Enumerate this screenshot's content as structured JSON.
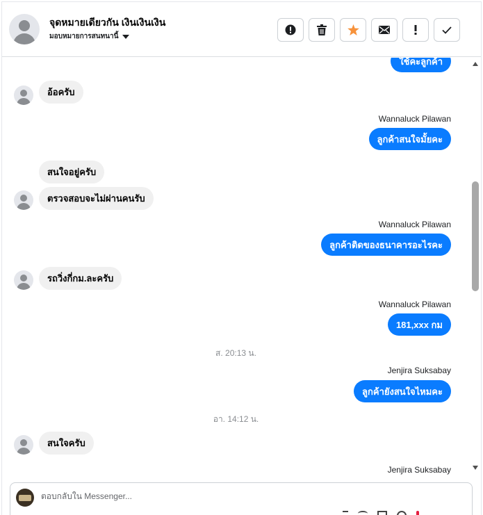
{
  "header": {
    "contact_name": "จุดหมายเดียวกัน เงินเงินเงิน",
    "assign_label": "มอบหมายการสนทนานี้",
    "actions": [
      {
        "name": "spam-button",
        "icon": "alert-circle-icon"
      },
      {
        "name": "delete-button",
        "icon": "trash-icon"
      },
      {
        "name": "star-button",
        "icon": "star-icon",
        "color": "#f7923b"
      },
      {
        "name": "mark-unread-button",
        "icon": "envelope-icon"
      },
      {
        "name": "follow-up-button",
        "icon": "exclamation-icon"
      },
      {
        "name": "mark-done-button",
        "icon": "checkmark-icon"
      }
    ]
  },
  "conversation": {
    "partial_top": "ใช้คะลูกค้า",
    "messages": [
      {
        "dir": "in",
        "text": "อ้อครับ"
      },
      {
        "dir": "out",
        "sender": "Wannaluck Pilawan",
        "text": "ลูกค้าสนใจมั้ยคะ"
      },
      {
        "dir": "in",
        "text": "สนใจอยู่ครับ"
      },
      {
        "dir": "in",
        "text": "ตรวจสอบจะไม่ผ่านคนรับ"
      },
      {
        "dir": "out",
        "sender": "Wannaluck Pilawan",
        "text": "ลูกค้าติดของธนาคารอะไรคะ"
      },
      {
        "dir": "in",
        "text": "รถวิ่งกี่กม.ละครับ"
      },
      {
        "dir": "out",
        "sender": "Wannaluck Pilawan",
        "text": "181,xxx  กม"
      },
      {
        "dir": "stamp",
        "text": "ส. 20:13 น."
      },
      {
        "dir": "out",
        "sender": "Jenjira Suksabay",
        "text": "ลูกค้ายังสนใจไหมคะ"
      },
      {
        "dir": "stamp",
        "text": "อา. 14:12 น."
      },
      {
        "dir": "in",
        "text": "สนใจครับ"
      },
      {
        "dir": "sender-only",
        "sender": "Jenjira Suksabay"
      }
    ]
  },
  "composer": {
    "placeholder": "ตอบกลับใน Messenger..."
  },
  "colors": {
    "outgoing_bubble": "#0a7cff",
    "incoming_bubble": "#f0f0f0",
    "star": "#f7923b"
  }
}
